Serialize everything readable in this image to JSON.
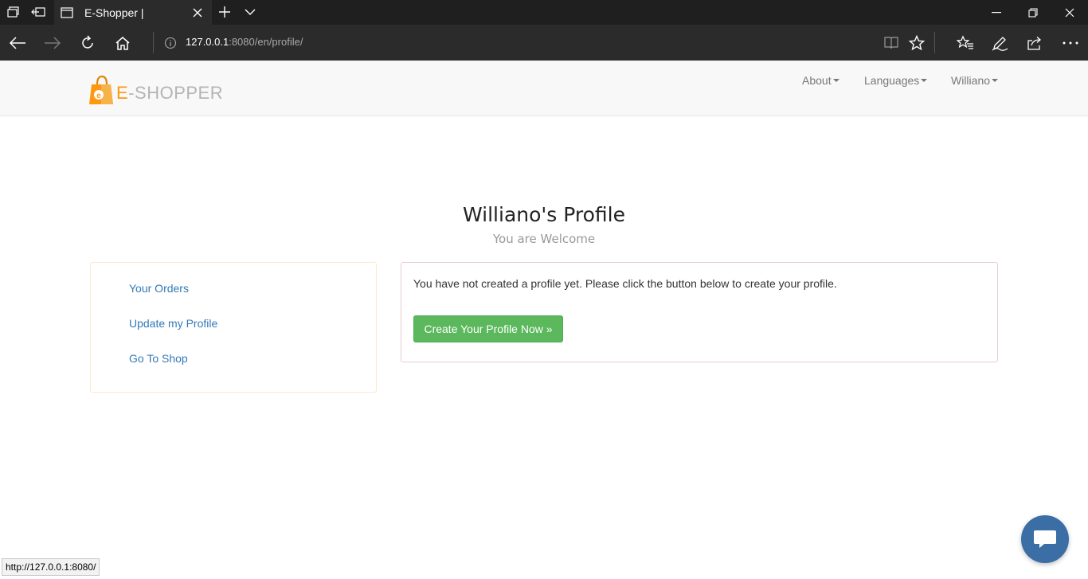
{
  "browser": {
    "tab_title": "E-Shopper |",
    "url_host": "127.0.0.1",
    "url_rest": ":8080/en/profile/",
    "status_url": "http://127.0.0.1:8080/"
  },
  "site": {
    "logo_first": "E",
    "logo_rest": "-SHOPPER",
    "nav": {
      "about": "About",
      "languages": "Languages",
      "user": "Williano"
    }
  },
  "profile": {
    "title": "Williano's Profile",
    "subtitle": "You are Welcome",
    "sidebar": [
      {
        "label": "Your Orders"
      },
      {
        "label": "Update my Profile"
      },
      {
        "label": "Go To Shop"
      }
    ],
    "message": "You have not created a profile yet. Please click the button below to create your profile.",
    "create_button": "Create Your Profile Now »"
  },
  "colors": {
    "brand": "#fe980f",
    "link": "#337ab7",
    "success": "#5cb85c",
    "chat": "#3a6ea5"
  }
}
